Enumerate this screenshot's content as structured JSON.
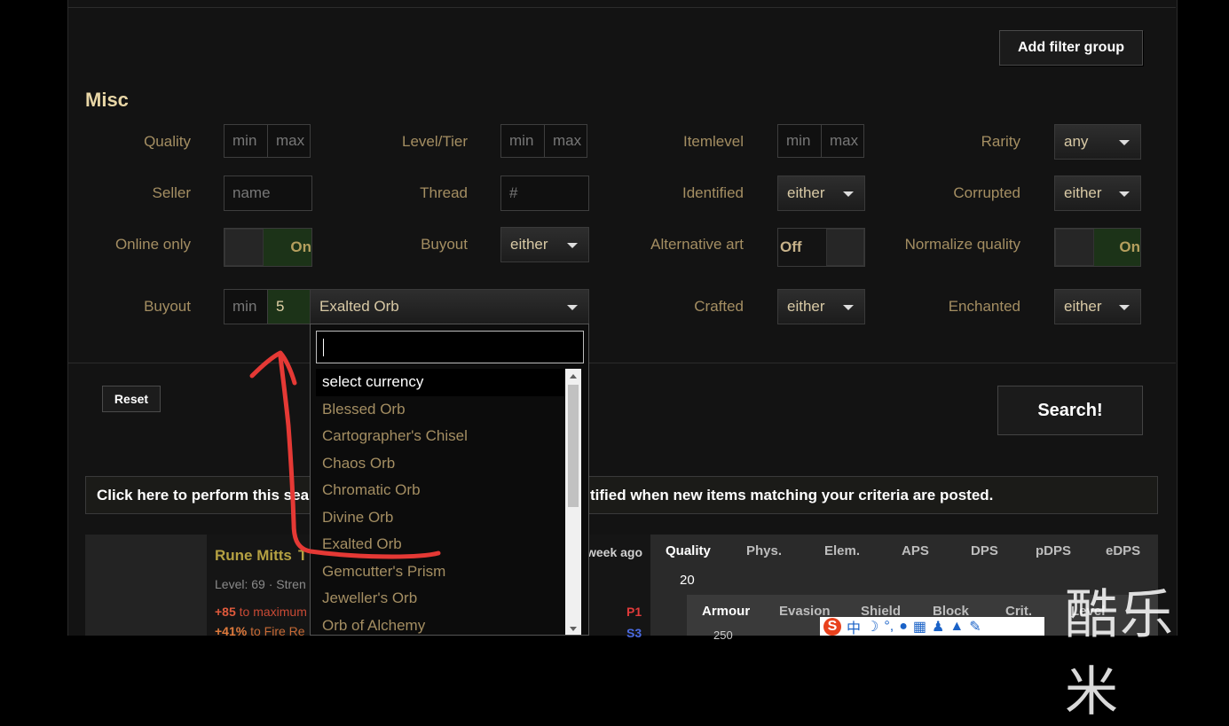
{
  "buttons": {
    "add_filter_group": "Add filter group",
    "reset": "Reset",
    "search": "Search!"
  },
  "misc": {
    "title": "Misc",
    "quality": {
      "label": "Quality",
      "min": "min",
      "max": "max"
    },
    "level_tier": {
      "label": "Level/Tier",
      "min": "min",
      "max": "max"
    },
    "itemlevel": {
      "label": "Itemlevel",
      "min": "min",
      "max": "max"
    },
    "rarity": {
      "label": "Rarity",
      "value": "any"
    },
    "seller": {
      "label": "Seller",
      "placeholder": "name"
    },
    "thread": {
      "label": "Thread",
      "placeholder": "#"
    },
    "identified": {
      "label": "Identified",
      "value": "either"
    },
    "corrupted": {
      "label": "Corrupted",
      "value": "either"
    },
    "online_only": {
      "label": "Online only",
      "state": "On"
    },
    "buyout_flag": {
      "label": "Buyout",
      "value": "either"
    },
    "alternative_art": {
      "label": "Alternative art",
      "state": "Off"
    },
    "normalize_quality": {
      "label": "Normalize quality",
      "state": "On"
    },
    "buyout": {
      "label": "Buyout",
      "min": "min",
      "max_value": "5",
      "currency": "Exalted Orb"
    },
    "crafted": {
      "label": "Crafted",
      "value": "either"
    },
    "enchanted": {
      "label": "Enchanted",
      "value": "either"
    }
  },
  "dropdown": {
    "items": [
      "select currency",
      "Blessed Orb",
      "Cartographer's Chisel",
      "Chaos Orb",
      "Chromatic Orb",
      "Divine Orb",
      "Exalted Orb",
      "Gemcutter's Prism",
      "Jeweller's Orb",
      "Orb of Alchemy"
    ],
    "selected_index": 0
  },
  "notify": {
    "left": "Click here to perform this sea",
    "right": "tified when new items matching your criteria are posted."
  },
  "result": {
    "name": "Rune Mitts",
    "name_suffix": "T",
    "level": "Level: 69 · Stren",
    "mod1_value": "+85",
    "mod1_text": " to maximum",
    "mod2_value": "+41%",
    "mod2_text": " to Fire Re",
    "time": "week ago",
    "headers": [
      "Quality",
      "Phys.",
      "Elem.",
      "APS",
      "DPS",
      "pDPS",
      "eDPS"
    ],
    "quality_value": "20",
    "sub_headers": [
      "Armour",
      "Evasion",
      "Shield",
      "Block",
      "Crit.",
      "Level"
    ],
    "armour_partial": "250",
    "tag1": "P1",
    "tag2": "S3"
  },
  "watermark": "酷乐米",
  "ime": {
    "lang": "中",
    "icon_letter": "S"
  },
  "colors": {
    "label": "#a48e62",
    "title": "#e8d6a6",
    "toggle_on": "#1c3318",
    "annotation": "#e53935"
  }
}
